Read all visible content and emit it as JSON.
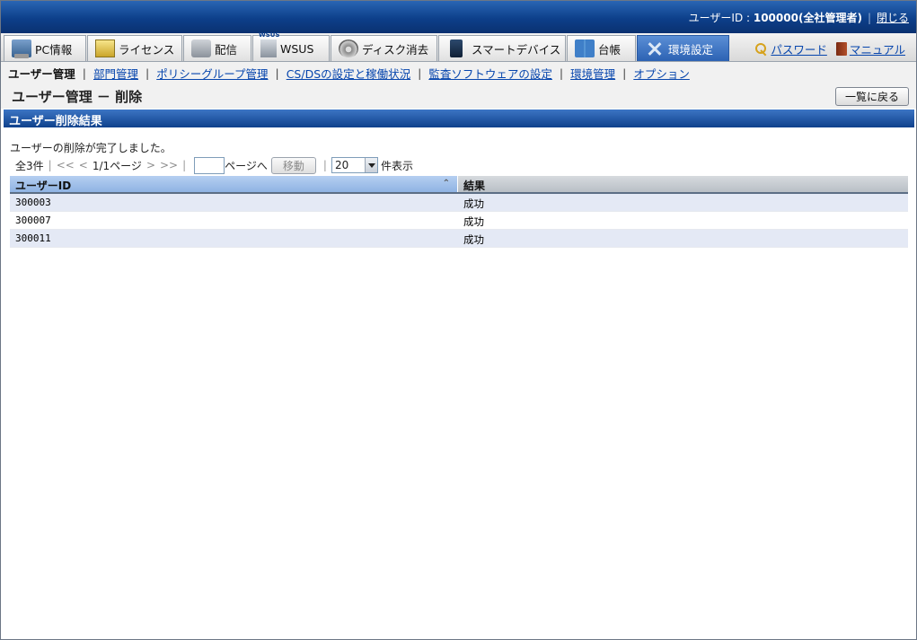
{
  "header": {
    "user_label": "ユーザーID : ",
    "user_value": "100000(全社管理者)",
    "close_link": "閉じる"
  },
  "tabs": [
    {
      "label": "PC情報",
      "icon": "pc-icon"
    },
    {
      "label": "ライセンス",
      "icon": "license-icon"
    },
    {
      "label": "配信",
      "icon": "distribution-icon"
    },
    {
      "label": "WSUS",
      "icon": "wsus-icon"
    },
    {
      "label": "ディスク消去",
      "icon": "disk-erase-icon"
    },
    {
      "label": "スマートデバイス",
      "icon": "smartphone-icon"
    },
    {
      "label": "台帳",
      "icon": "ledger-icon"
    },
    {
      "label": "環境設定",
      "icon": "tools-icon",
      "active": true
    }
  ],
  "top_links": {
    "password": "パスワード",
    "manual": "マニュアル"
  },
  "subnav": {
    "current": "ユーザー管理",
    "links": [
      "部門管理",
      "ポリシーグループ管理",
      "CS/DSの設定と稼働状況",
      "監査ソフトウェアの設定",
      "環境管理",
      "オプション"
    ]
  },
  "page": {
    "title": "ユーザー管理 － 削除",
    "back_button": "一覧に戻る",
    "section_title": "ユーザー削除結果",
    "message": "ユーザーの削除が完了しました。"
  },
  "pager": {
    "total": "全3件",
    "first": "<<",
    "prev": "<",
    "page_info": "1/1ページ",
    "next": ">",
    "last": ">>",
    "page_input_value": "",
    "goto_label": "ページへ",
    "move_button": "移動",
    "per_page_value": "20",
    "per_page_suffix": "件表示"
  },
  "table": {
    "columns": [
      "ユーザーID",
      "結果"
    ],
    "rows": [
      [
        "300003",
        "成功"
      ],
      [
        "300007",
        "成功"
      ],
      [
        "300011",
        "成功"
      ]
    ]
  },
  "colors": {
    "header_blue": "#0d3f8a",
    "active_tab": "#2c62b3",
    "link": "#0645ad"
  }
}
